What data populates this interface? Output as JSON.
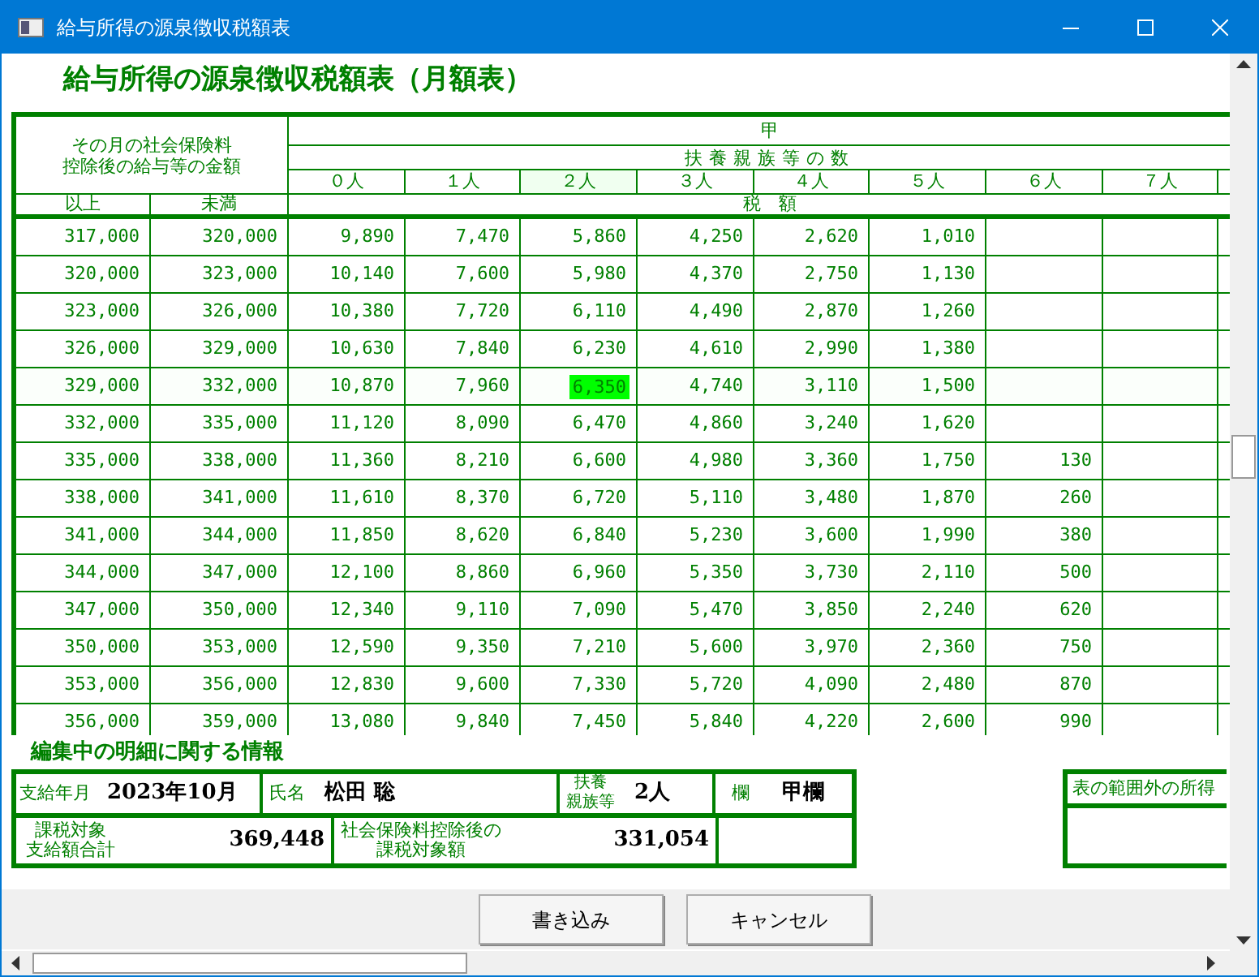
{
  "window": {
    "title": "給与所得の源泉徴収税額表"
  },
  "heading": "給与所得の源泉徴収税額表（月額表）",
  "table": {
    "range_header": [
      "その月の社会保険料",
      "控除後の給与等の金額"
    ],
    "group_header": "甲",
    "dependents_header": "扶養親族等の数",
    "lower_header": "以上",
    "upper_header": "未満",
    "tax_header": "税　額",
    "columns": [
      {
        "label": "０人",
        "selected": false
      },
      {
        "label": "１人",
        "selected": false
      },
      {
        "label": "２人",
        "selected": true
      },
      {
        "label": "３人",
        "selected": false
      },
      {
        "label": "４人",
        "selected": false
      },
      {
        "label": "５人",
        "selected": false
      },
      {
        "label": "６人",
        "selected": false
      },
      {
        "label": "７人",
        "selected": false
      }
    ],
    "rows": [
      {
        "lower": "317,000",
        "upper": "320,000",
        "values": [
          "9,890",
          "7,470",
          "5,860",
          "4,250",
          "2,620",
          "1,010"
        ],
        "selected": false
      },
      {
        "lower": "320,000",
        "upper": "323,000",
        "values": [
          "10,140",
          "7,600",
          "5,980",
          "4,370",
          "2,750",
          "1,130"
        ],
        "selected": false
      },
      {
        "lower": "323,000",
        "upper": "326,000",
        "values": [
          "10,380",
          "7,720",
          "6,110",
          "4,490",
          "2,870",
          "1,260"
        ],
        "selected": false
      },
      {
        "lower": "326,000",
        "upper": "329,000",
        "values": [
          "10,630",
          "7,840",
          "6,230",
          "4,610",
          "2,990",
          "1,380"
        ],
        "selected": false
      },
      {
        "lower": "329,000",
        "upper": "332,000",
        "values": [
          "10,870",
          "7,960",
          "6,350",
          "4,740",
          "3,110",
          "1,500"
        ],
        "selected": true
      },
      {
        "lower": "332,000",
        "upper": "335,000",
        "values": [
          "11,120",
          "8,090",
          "6,470",
          "4,860",
          "3,240",
          "1,620"
        ],
        "selected": false
      },
      {
        "lower": "335,000",
        "upper": "338,000",
        "values": [
          "11,360",
          "8,210",
          "6,600",
          "4,980",
          "3,360",
          "1,750",
          "130"
        ],
        "selected": false
      },
      {
        "lower": "338,000",
        "upper": "341,000",
        "values": [
          "11,610",
          "8,370",
          "6,720",
          "5,110",
          "3,480",
          "1,870",
          "260"
        ],
        "selected": false
      },
      {
        "lower": "341,000",
        "upper": "344,000",
        "values": [
          "11,850",
          "8,620",
          "6,840",
          "5,230",
          "3,600",
          "1,990",
          "380"
        ],
        "selected": false
      },
      {
        "lower": "344,000",
        "upper": "347,000",
        "values": [
          "12,100",
          "8,860",
          "6,960",
          "5,350",
          "3,730",
          "2,110",
          "500"
        ],
        "selected": false
      },
      {
        "lower": "347,000",
        "upper": "350,000",
        "values": [
          "12,340",
          "9,110",
          "7,090",
          "5,470",
          "3,850",
          "2,240",
          "620"
        ],
        "selected": false
      },
      {
        "lower": "350,000",
        "upper": "353,000",
        "values": [
          "12,590",
          "9,350",
          "7,210",
          "5,600",
          "3,970",
          "2,360",
          "750"
        ],
        "selected": false
      },
      {
        "lower": "353,000",
        "upper": "356,000",
        "values": [
          "12,830",
          "9,600",
          "7,330",
          "5,720",
          "4,090",
          "2,480",
          "870"
        ],
        "selected": false
      },
      {
        "lower": "356,000",
        "upper": "359,000",
        "values": [
          "13,080",
          "9,840",
          "7,450",
          "5,840",
          "4,220",
          "2,600",
          "990"
        ],
        "selected": false
      }
    ]
  },
  "detail": {
    "title": "編集中の明細に関する情報",
    "pay_month_label": "支給年月",
    "pay_month": "2023年10月",
    "name_label": "氏名",
    "name": "松田 聡",
    "dependents_label": [
      "扶養",
      "親族等"
    ],
    "dependents": "2人",
    "column_label": "欄",
    "column": "甲欄",
    "taxable_total_label": [
      "課税対象",
      "支給額合計"
    ],
    "taxable_total": "369,448",
    "after_insurance_label": [
      "社会保険料控除後の",
      "課税対象額"
    ],
    "after_insurance": "331,054"
  },
  "out_of_range": {
    "title": "表の範囲外の所得"
  },
  "buttons": [
    "書き込み",
    "キャンセル"
  ]
}
